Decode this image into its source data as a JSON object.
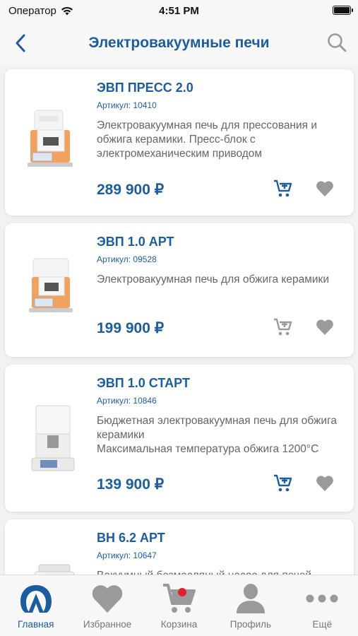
{
  "status_bar": {
    "carrier": "Оператор",
    "time": "4:51 PM",
    "battery_level": 1.0
  },
  "nav": {
    "title": "Электровакуумные печи",
    "back_icon": "chevron-left-icon",
    "search_icon": "search-icon"
  },
  "products": [
    {
      "name": "ЭВП ПРЕСС 2.0",
      "sku": "Артикул: 10410",
      "description": "Электровакуумная печь для прессования и обжига керамики. Пресс-блок с электромеханическим приводом",
      "price": "289 900 ₽",
      "in_cart": true
    },
    {
      "name": "ЭВП 1.0 АРТ",
      "sku": "Артикул: 09528",
      "description": "Электровакуумная печь для обжига керамики",
      "price": "199 900 ₽",
      "in_cart": false
    },
    {
      "name": "ЭВП 1.0 СТАРТ",
      "sku": "Артикул: 10846",
      "description": "Бюджетная электровакуумная печь для обжига керамики\nМаксимальная температура обжига 1200°С",
      "price": "139 900 ₽",
      "in_cart": true
    },
    {
      "name": "ВН 6.2 АРТ",
      "sku": "Артикул: 10647",
      "description": "Вакуумный безмасляный насос для печей",
      "price": "",
      "in_cart": false
    }
  ],
  "tabs": [
    {
      "label": "Главная",
      "icon": "home-logo-icon",
      "active": true
    },
    {
      "label": "Избранное",
      "icon": "heart-icon",
      "active": false
    },
    {
      "label": "Корзина",
      "icon": "cart-icon",
      "active": false,
      "badge_color": "#e0202a"
    },
    {
      "label": "Профиль",
      "icon": "profile-icon",
      "active": false
    },
    {
      "label": "Ещё",
      "icon": "more-icon",
      "active": false
    }
  ],
  "colors": {
    "accent": "#1b5d9e",
    "muted_icon": "#9a9a9a",
    "badge": "#e0202a"
  }
}
